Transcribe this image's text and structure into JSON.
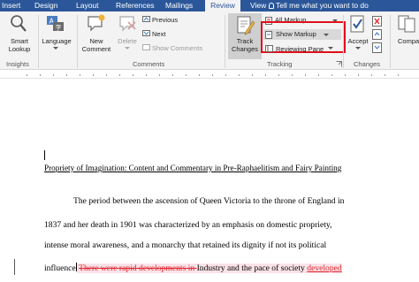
{
  "tabs": [
    {
      "label": "Insert"
    },
    {
      "label": "Design"
    },
    {
      "label": "Layout"
    },
    {
      "label": "References"
    },
    {
      "label": "Mailings"
    },
    {
      "label": "Review"
    },
    {
      "label": "View"
    }
  ],
  "tell_me": "Tell me what you want to do",
  "ribbon": {
    "insights": {
      "smart_lookup_line1": "Smart",
      "smart_lookup_line2": "Lookup",
      "group_label": "Insights"
    },
    "language": {
      "label": "Language"
    },
    "comments": {
      "new_comment_line1": "New",
      "new_comment_line2": "Comment",
      "delete": "Delete",
      "previous": "Previous",
      "next": "Next",
      "show_comments": "Show Comments",
      "group_label": "Comments"
    },
    "tracking": {
      "track_changes_line1": "Track",
      "track_changes_line2": "Changes",
      "display_for_review": "All Markup",
      "show_markup": "Show Markup",
      "reviewing_pane": "Reviewing Pane",
      "group_label": "Tracking"
    },
    "changes": {
      "accept": "Accept",
      "group_label": "Changes"
    },
    "compare": {
      "label": "Compa"
    }
  },
  "document": {
    "title": "Propriety of Imagination: Content and Commentary in Pre-Raphaelitism and Fairy Painting",
    "line1": "The period between the ascension of Queen Victoria to the throne of England in",
    "line2": "1837 and her death in 1901 was characterized by an emphasis on domestic propriety,",
    "line3": "intense moral awareness, and a monarchy that retained its dignity if not its political",
    "line4_start": "influence",
    "line4_deleted": "There were rapid developments in ",
    "line4_mid": "Industry and the pace of society",
    "line4_inserted": "developed"
  },
  "colors": {
    "accent": "#2b579a",
    "highlight": "#e0101b",
    "markup": "#e0242e"
  }
}
